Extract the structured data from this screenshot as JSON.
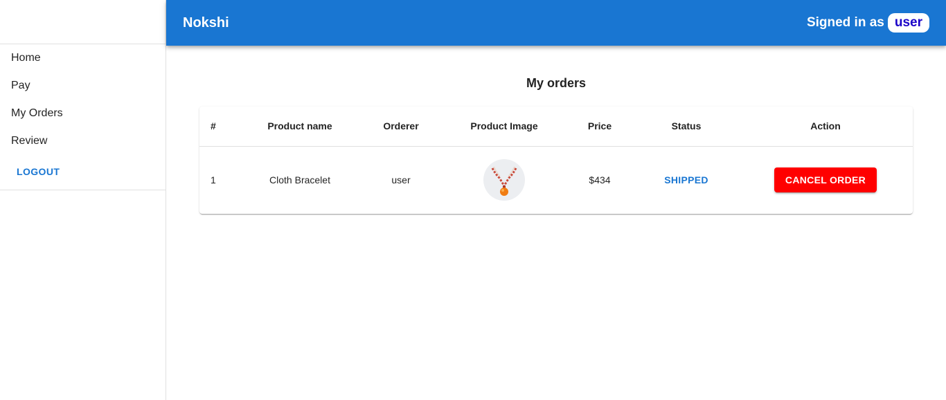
{
  "app": {
    "brand": "Nokshi",
    "signed_in_label": "Signed in as",
    "username": "user"
  },
  "sidebar": {
    "items": [
      {
        "label": "Home"
      },
      {
        "label": "Pay"
      },
      {
        "label": "My Orders"
      },
      {
        "label": "Review"
      }
    ],
    "logout_label": "LOGOUT"
  },
  "page": {
    "title": "My orders"
  },
  "orders_table": {
    "headers": [
      "#",
      "Product name",
      "Orderer",
      "Product Image",
      "Price",
      "Status",
      "Action"
    ],
    "rows": [
      {
        "num": "1",
        "product_name": "Cloth Bracelet",
        "orderer": "user",
        "product_image": "bracelet-thumbnail",
        "price": "$434",
        "status": "SHIPPED",
        "action": "CANCEL ORDER"
      }
    ]
  },
  "colors": {
    "primary": "#1976d2",
    "danger": "#ff0000",
    "username_text": "#1a00c8"
  }
}
